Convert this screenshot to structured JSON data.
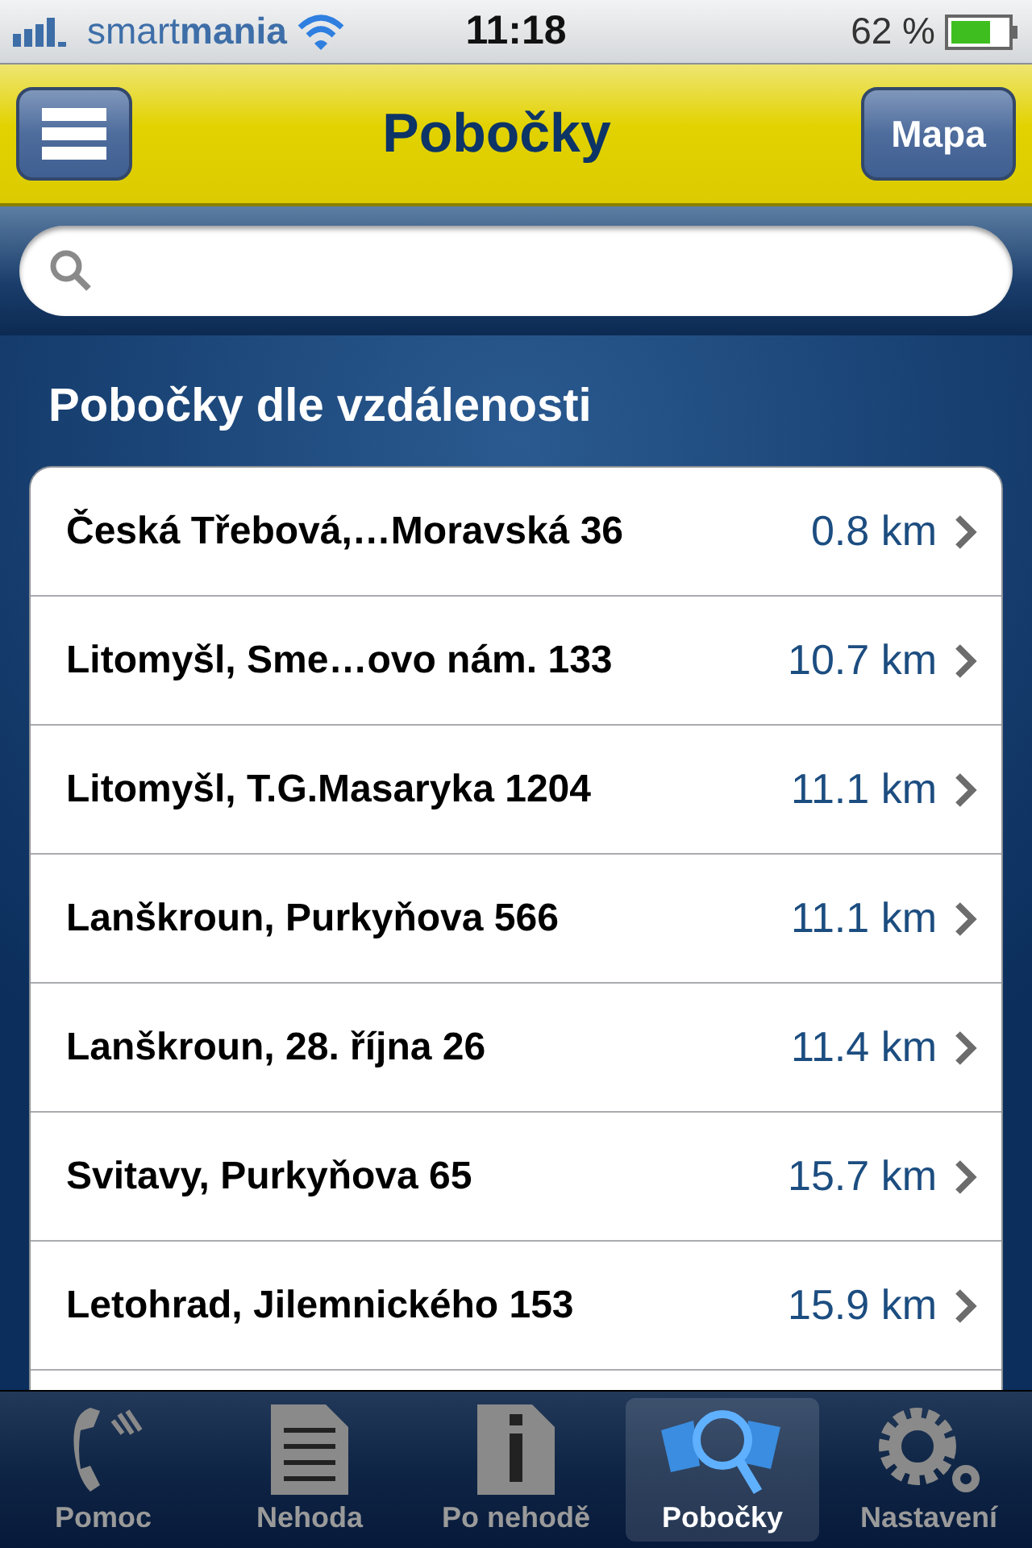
{
  "status_bar": {
    "carrier": "smart**mania**",
    "time": "11:18",
    "battery": "62 %"
  },
  "nav_bar": {
    "title": "Pobočky",
    "right_button": "Mapa"
  },
  "section_title": "Pobočky dle vzdálenosti",
  "branches": [
    {
      "name": "Česká Třebová,…Moravská 36",
      "distance": "0.8 km"
    },
    {
      "name": "Litomyšl, Sme…ovo nám. 133",
      "distance": "10.7 km"
    },
    {
      "name": "Litomyšl, T.G.Masaryka 1204",
      "distance": "11.1 km"
    },
    {
      "name": "Lanškroun, Purkyňova 566",
      "distance": "11.1 km"
    },
    {
      "name": "Lanškroun, 28. října 26",
      "distance": "11.4 km"
    },
    {
      "name": "Svitavy, Purkyňova 65",
      "distance": "15.7 km"
    },
    {
      "name": "Letohrad, Jilemnického 153",
      "distance": "15.9 km"
    }
  ],
  "tab_bar": [
    {
      "label": "Pomoc",
      "kind": "phone",
      "selected": false
    },
    {
      "label": "Nehoda",
      "kind": "document",
      "selected": false
    },
    {
      "label": "Po nehodě",
      "kind": "info",
      "selected": false
    },
    {
      "label": "Pobočky",
      "kind": "search",
      "selected": true
    },
    {
      "label": "Nastavení",
      "kind": "gear",
      "selected": false
    }
  ]
}
